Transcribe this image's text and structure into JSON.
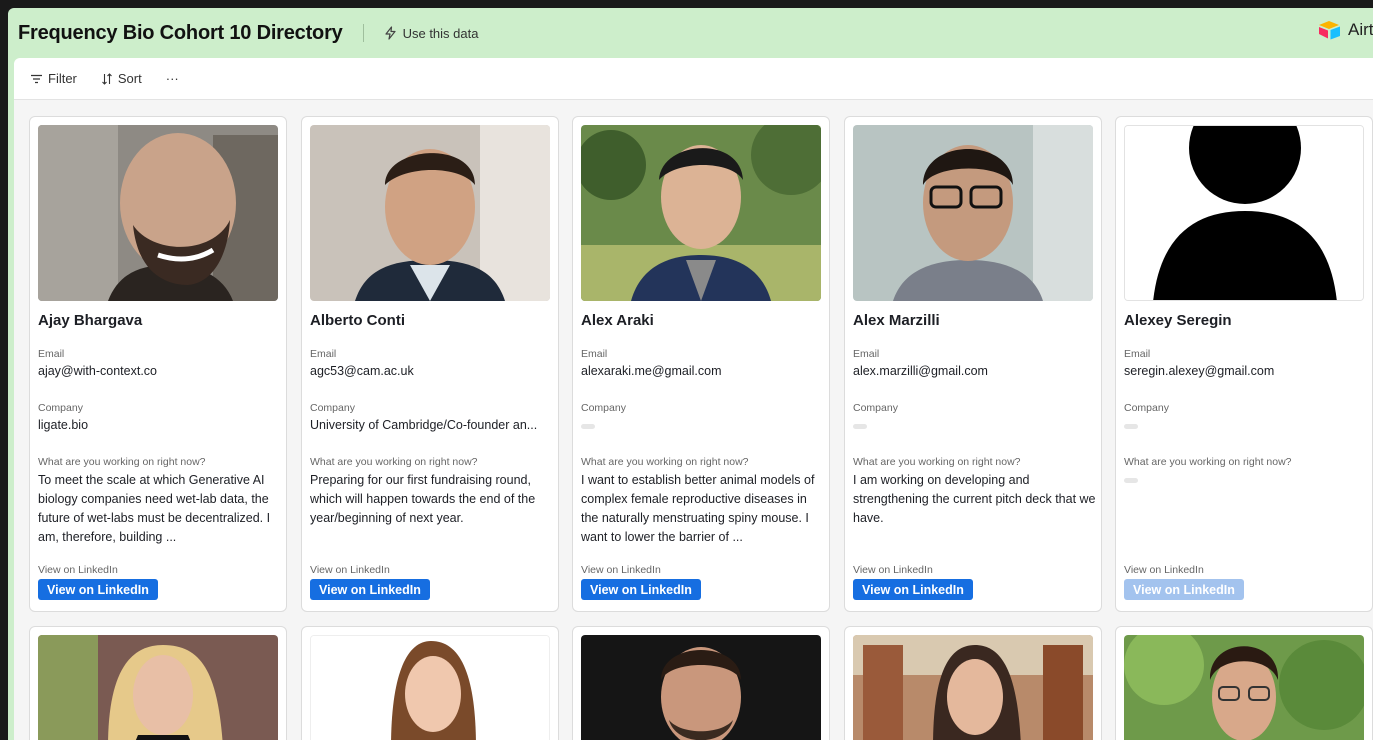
{
  "header": {
    "title": "Frequency Bio Cohort 10 Directory",
    "use_data": "Use this data",
    "brand": "Airta"
  },
  "toolbar": {
    "filter": "Filter",
    "sort": "Sort",
    "more": "···"
  },
  "labels": {
    "email": "Email",
    "company": "Company",
    "working": "What are you working on right now?",
    "view_label": "View on LinkedIn",
    "view_button": "View on LinkedIn"
  },
  "cards": [
    {
      "name": "Ajay Bhargava",
      "email": "ajay@with-context.co",
      "company": "ligate.bio",
      "working": "To meet the scale at which Generative AI biology companies need wet-lab data, the future of wet-labs must be decentralized. I am, therefore, building ...",
      "linkedin_enabled": true
    },
    {
      "name": "Alberto Conti",
      "email": "agc53@cam.ac.uk",
      "company": "University of Cambridge/Co-founder an...",
      "working": "Preparing for our first fundraising round, which will happen towards the end of the year/beginning of next year.",
      "linkedin_enabled": true
    },
    {
      "name": "Alex Araki",
      "email": "alexaraki.me@gmail.com",
      "company": "",
      "working": "I want to establish better animal models of complex female reproductive diseases in the naturally menstruating spiny mouse. I want to lower the barrier of ...",
      "linkedin_enabled": true
    },
    {
      "name": "Alex Marzilli",
      "email": "alex.marzilli@gmail.com",
      "company": "",
      "working": "I am working on developing and strengthening the current pitch deck that we have.",
      "linkedin_enabled": true
    },
    {
      "name": "Alexey Seregin",
      "email": "seregin.alexey@gmail.com",
      "company": "",
      "working": "",
      "linkedin_enabled": false
    }
  ],
  "colors": {
    "header_bg": "#cdeecb",
    "button_blue": "#166ee1",
    "button_disabled": "#a3c3ee"
  }
}
